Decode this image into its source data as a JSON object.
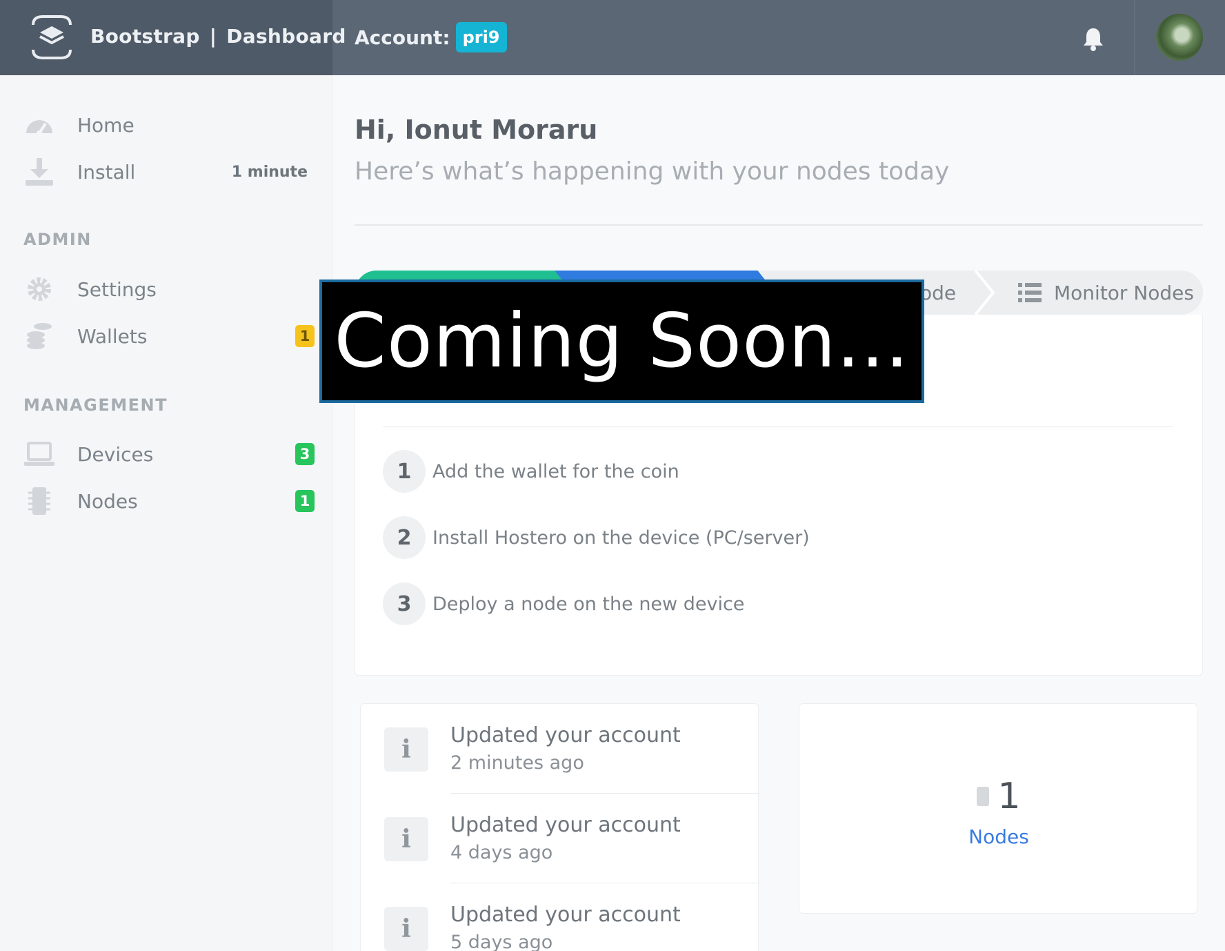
{
  "header": {
    "brand_name": "Bootstrap",
    "brand_separator": "|",
    "brand_section": "Dashboard",
    "account_label": "Account:",
    "account_id": "pri9"
  },
  "sidebar": {
    "home_label": "Home",
    "install_label": "Install",
    "install_meta": "1 minute",
    "admin_title": "ADMIN",
    "settings_label": "Settings",
    "wallets_label": "Wallets",
    "wallets_count": "1",
    "management_title": "MANAGEMENT",
    "devices_label": "Devices",
    "devices_count": "3",
    "nodes_label": "Nodes",
    "nodes_count": "1"
  },
  "main": {
    "greeting": "Hi, Ionut Moraru",
    "subgreeting": "Here’s what’s happening with your nodes today",
    "steps_bar": {
      "deploy_partial": "ode",
      "monitor_label": "Monitor Nodes"
    },
    "todo": [
      {
        "num": "1",
        "text": "Add the wallet for the coin"
      },
      {
        "num": "2",
        "text": "Install Hostero on the device (PC/server)"
      },
      {
        "num": "3",
        "text": "Deploy a node on the new device"
      }
    ],
    "activity": [
      {
        "icon": "i",
        "title": "Updated your account",
        "time": "2 minutes ago"
      },
      {
        "icon": "i",
        "title": "Updated your account",
        "time": "4 days ago"
      },
      {
        "icon": "i",
        "title": "Updated your account",
        "time": "5 days ago"
      }
    ],
    "nodes_stat": {
      "value": "1",
      "label": "Nodes"
    }
  },
  "overlay": {
    "text": "Coming Soon..."
  },
  "colors": {
    "header_bg": "#5b6775",
    "brand_bg": "#4f5a68",
    "account_badge": "#16b4d4",
    "badge_yellow": "#f6c21c",
    "badge_green": "#27c55c",
    "step_green": "#1fbf91",
    "step_blue": "#2f7be0",
    "link_blue": "#3a7be0",
    "overlay_border": "#1b6aa0"
  },
  "icons": [
    "logo-stack-icon",
    "bell-icon",
    "dashboard-icon",
    "download-icon",
    "gear-icon",
    "coins-icon",
    "laptop-icon",
    "chip-icon",
    "list-icon",
    "info-icon"
  ]
}
